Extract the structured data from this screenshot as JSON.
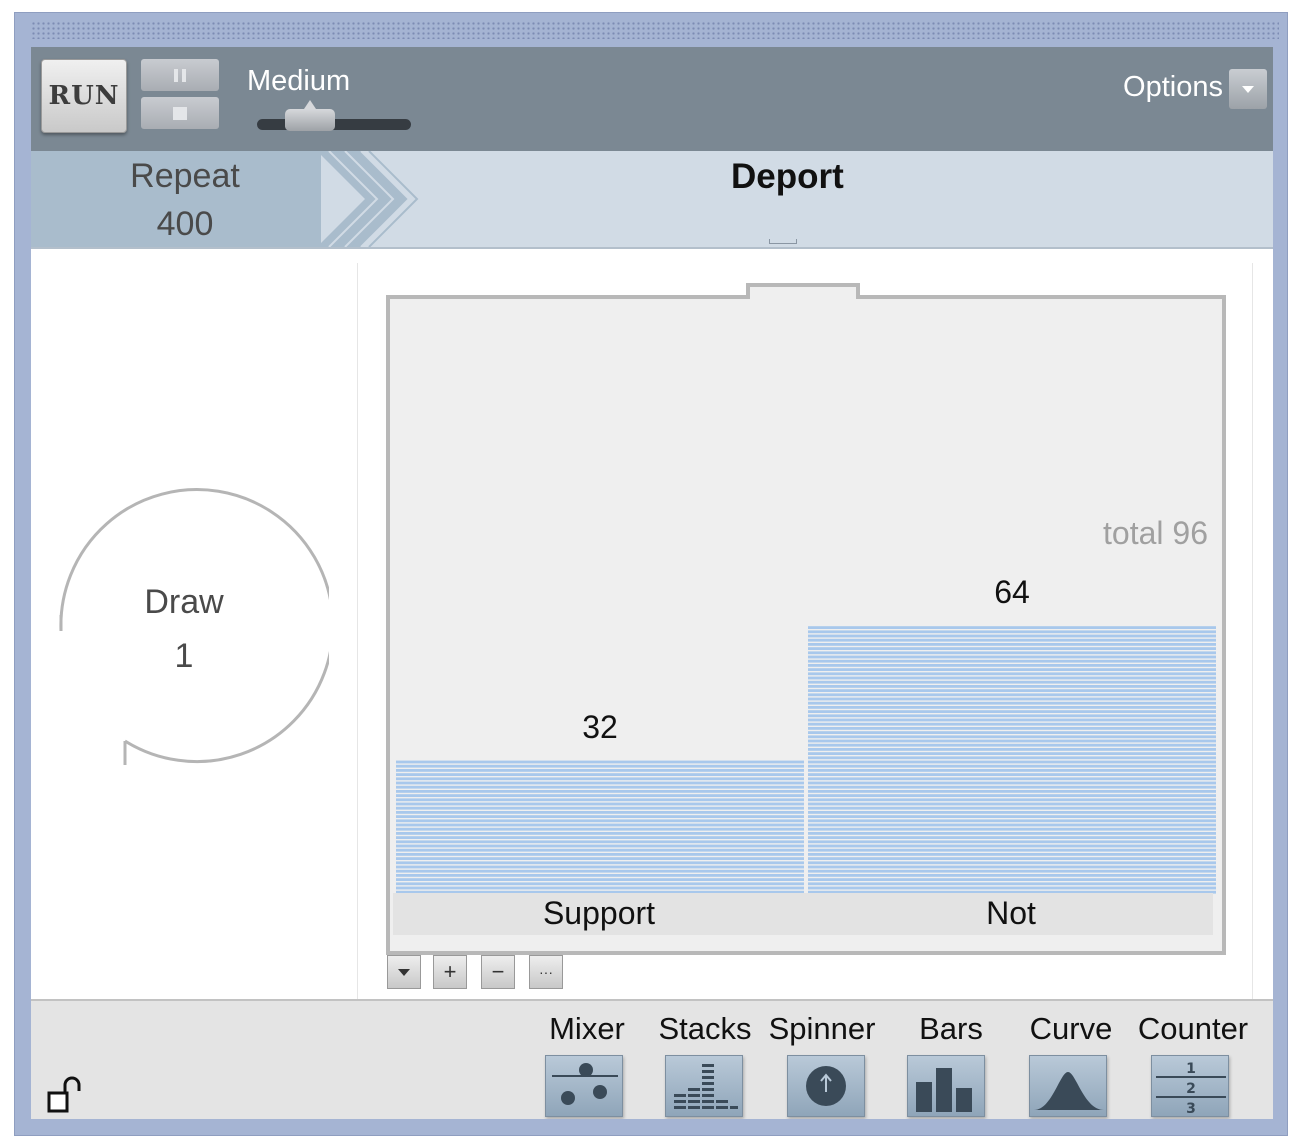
{
  "toolbar": {
    "run_label": "RUN",
    "speed_label": "Medium",
    "options_label": "Options"
  },
  "header": {
    "repeat_label": "Repeat",
    "repeat_value": "400",
    "device_title": "Deport"
  },
  "draw": {
    "label": "Draw",
    "value": "1"
  },
  "device": {
    "total_label": "total 96",
    "zoom_buttons": [
      "+",
      "−",
      "···"
    ]
  },
  "chart_data": {
    "type": "bar",
    "categories": [
      "Support",
      "Not"
    ],
    "values": [
      32,
      64
    ],
    "total": 96,
    "bar_color": "#a8c8ec",
    "ylim": [
      0,
      80
    ]
  },
  "palette": {
    "items": [
      "Mixer",
      "Stacks",
      "Spinner",
      "Bars",
      "Curve",
      "Counter"
    ]
  },
  "colors": {
    "toolbar": "#7b8893",
    "header_band": "#d1dbe5",
    "frame": "#a5b4d3",
    "bar_fill": "#a8c8ec"
  }
}
